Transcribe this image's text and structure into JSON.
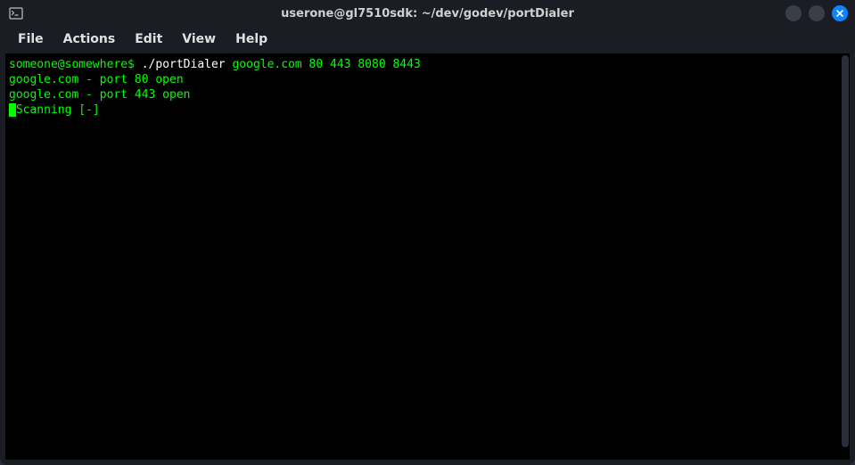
{
  "window": {
    "title": "userone@gl7510sdk: ~/dev/godev/portDialer"
  },
  "menubar": {
    "items": [
      "File",
      "Actions",
      "Edit",
      "View",
      "Help"
    ]
  },
  "terminal": {
    "prompt": "someone@somewhere$ ",
    "command_white": "./portDialer",
    "command_args": " google.com 80 443 8080 8443",
    "output_lines": [
      "google.com - port 80 open",
      "google.com - port 443 open"
    ],
    "cursor_char": " ",
    "scanning_text": "Scanning [-]"
  }
}
